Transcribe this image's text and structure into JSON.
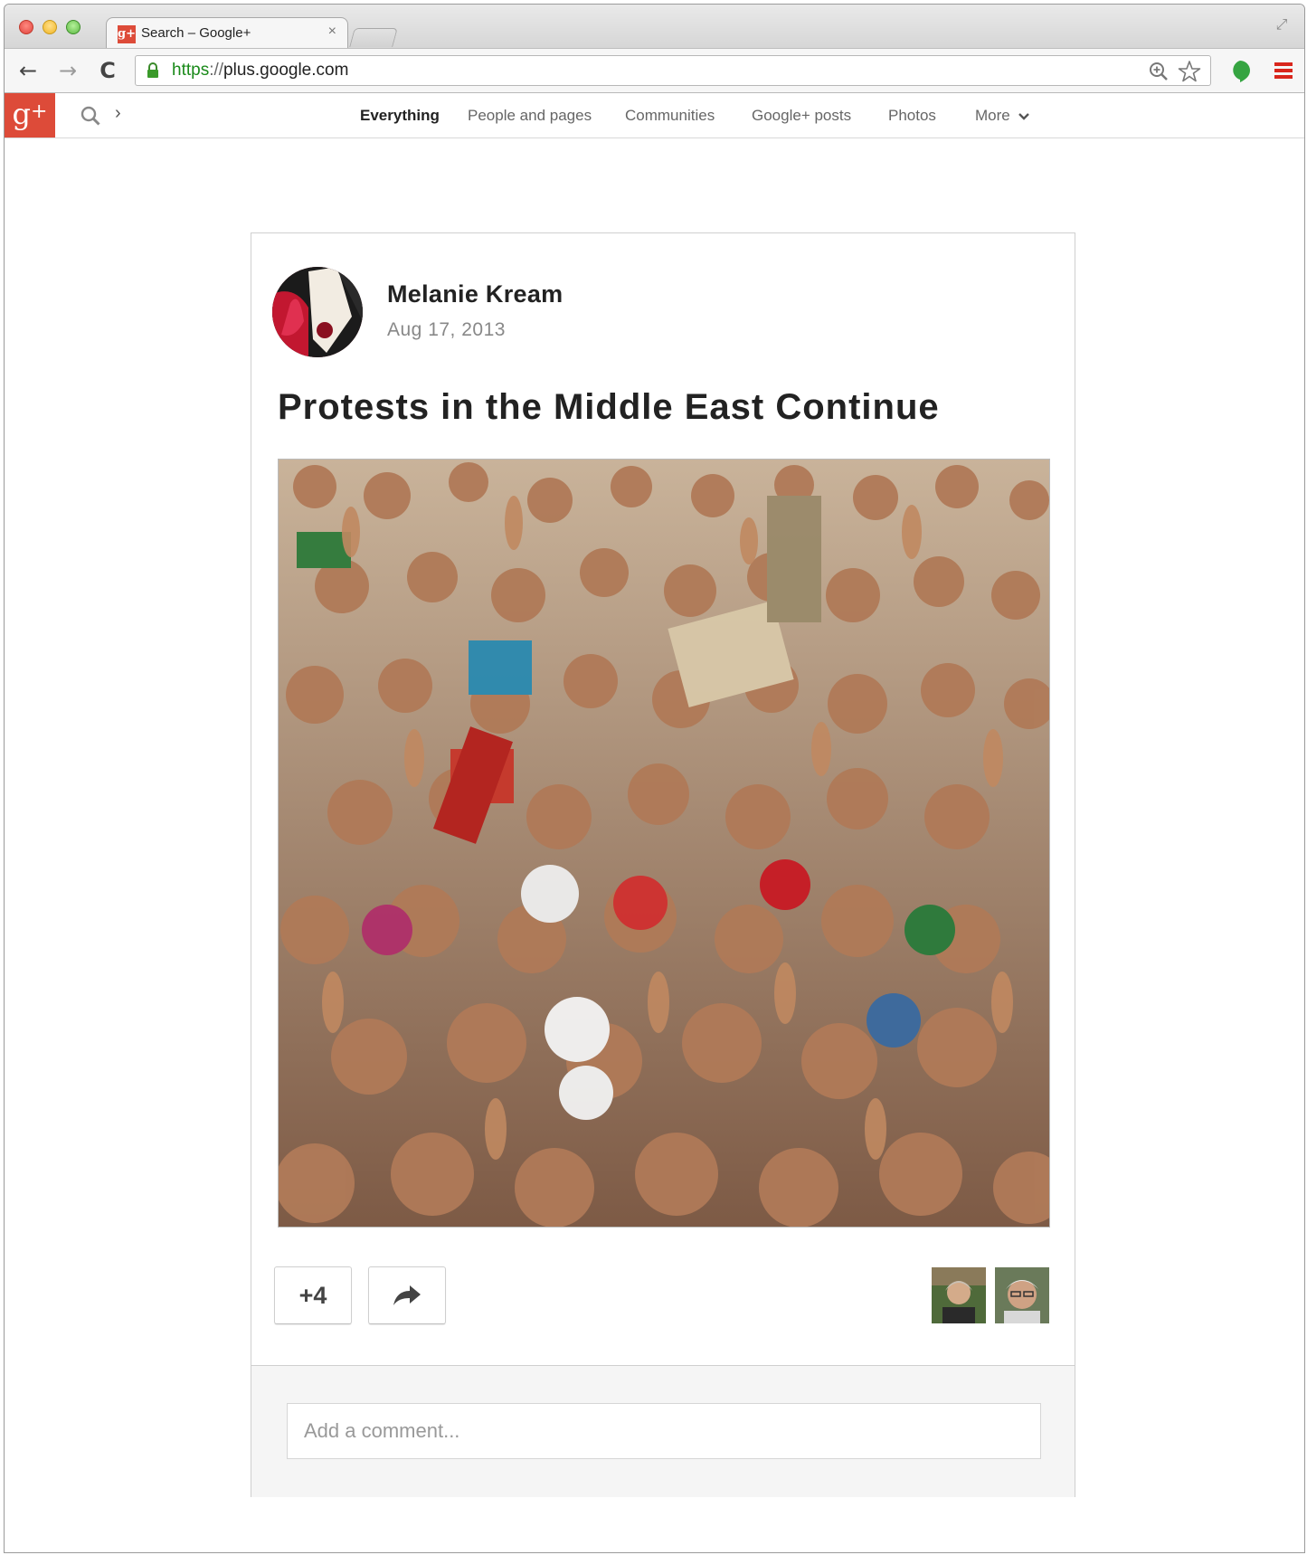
{
  "browser": {
    "tab_favicon": "g+",
    "tab_title": "Search – Google+",
    "tab_close": "×",
    "url_scheme": "https",
    "url_sep": "://",
    "url_host": "plus.google.com",
    "back_glyph": "←",
    "forward_glyph": "→",
    "reload_glyph": "C",
    "fullscreen_glyph": "⤢"
  },
  "gplus_bar": {
    "logo_g": "g",
    "logo_plus": "+",
    "search_chevron": "›",
    "tabs": [
      {
        "label": "Everything",
        "active": true
      },
      {
        "label": "People and pages",
        "active": false
      },
      {
        "label": "Communities",
        "active": false
      },
      {
        "label": "Google+ posts",
        "active": false
      },
      {
        "label": "Photos",
        "active": false
      },
      {
        "label": "More",
        "active": false
      }
    ]
  },
  "post": {
    "author": "Melanie Kream",
    "date": "Aug 17, 2013",
    "title": "Protests in the Middle East Continue",
    "plus_count": "+4",
    "comment_placeholder": "Add a comment..."
  },
  "colors": {
    "gplus_red": "#dd4b39",
    "url_green": "#1a8a1a",
    "menu_red": "#d9261c",
    "hangouts_green": "#35a441"
  },
  "icons": [
    "lock-icon",
    "zoom-icon",
    "star-icon",
    "hangouts-icon",
    "menu-icon",
    "search-icon",
    "share-icon"
  ]
}
